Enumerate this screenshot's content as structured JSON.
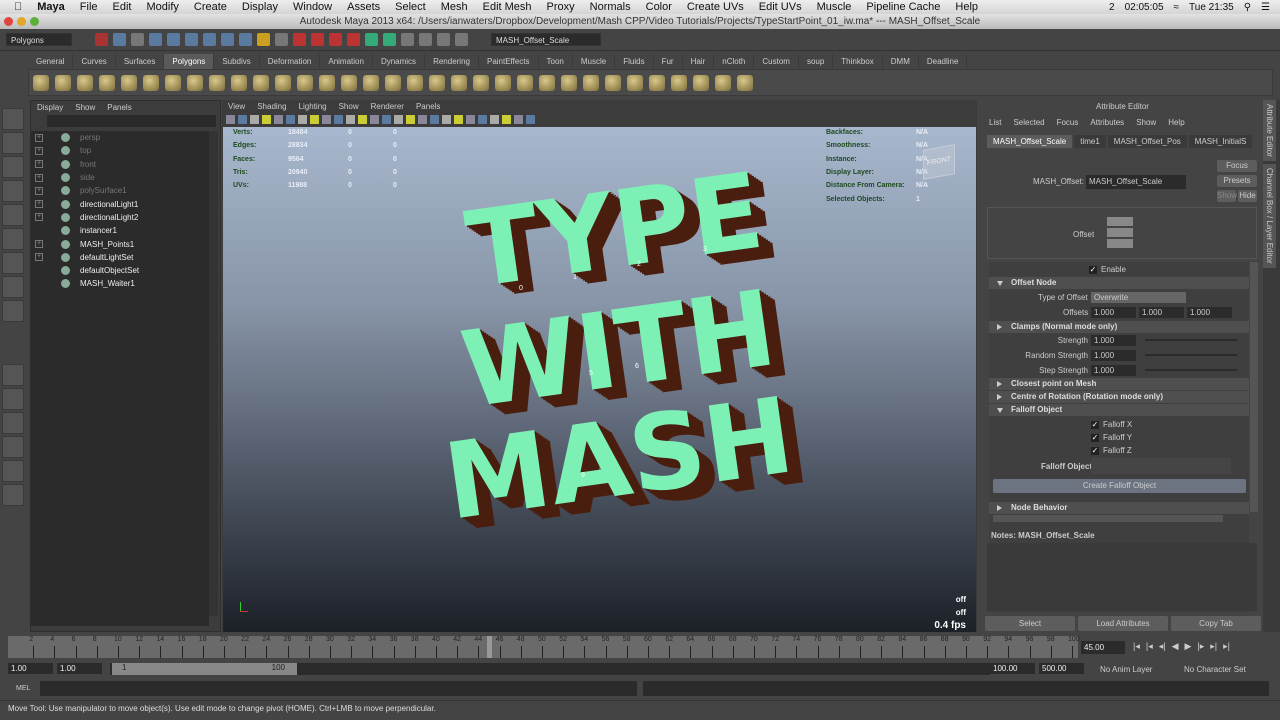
{
  "macmenu": {
    "app": "Maya",
    "items": [
      "File",
      "Edit",
      "Modify",
      "Create",
      "Display",
      "Window",
      "Assets",
      "Select",
      "Mesh",
      "Edit Mesh",
      "Proxy",
      "Normals",
      "Color",
      "Create UVs",
      "Edit UVs",
      "Muscle",
      "Pipeline Cache",
      "Help"
    ],
    "clock": "Tue 21:35",
    "timer": "02:05:05",
    "badge": "2"
  },
  "window_title": "Autodesk Maya 2013 x64: /Users/ianwaters/Dropbox/Development/Mash CPP/Video Tutorials/Projects/TypeStartPoint_01_iw.ma*  ---  MASH_Offset_Scale",
  "statusline": {
    "menuset": "Polygons",
    "name_field": "MASH_Offset_Scale"
  },
  "shelf_tabs": [
    "General",
    "Curves",
    "Surfaces",
    "Polygons",
    "Subdivs",
    "Deformation",
    "Animation",
    "Dynamics",
    "Rendering",
    "PaintEffects",
    "Toon",
    "Muscle",
    "Fluids",
    "Fur",
    "Hair",
    "nCloth",
    "Custom",
    "soup",
    "Thinkbox",
    "DMM",
    "Deadline"
  ],
  "shelf_active": "Polygons",
  "outliner": {
    "menu": [
      "Display",
      "Show",
      "Panels"
    ],
    "items": [
      {
        "label": "persp",
        "dim": true,
        "expand": true
      },
      {
        "label": "top",
        "dim": true,
        "expand": true
      },
      {
        "label": "front",
        "dim": true,
        "expand": true
      },
      {
        "label": "side",
        "dim": true,
        "expand": true
      },
      {
        "label": "polySurface1",
        "dim": true,
        "expand": true
      },
      {
        "label": "directionalLight1",
        "dim": false,
        "expand": true
      },
      {
        "label": "directionalLight2",
        "dim": false,
        "expand": true
      },
      {
        "label": "instancer1",
        "dim": false,
        "expand": false
      },
      {
        "label": "MASH_Points1",
        "dim": false,
        "expand": true
      },
      {
        "label": "defaultLightSet",
        "dim": false,
        "expand": true
      },
      {
        "label": "defaultObjectSet",
        "dim": false,
        "expand": false
      },
      {
        "label": "MASH_Waiter1",
        "dim": false,
        "expand": false
      }
    ]
  },
  "viewport": {
    "menu": [
      "View",
      "Shading",
      "Lighting",
      "Show",
      "Renderer",
      "Panels"
    ],
    "stats": [
      {
        "label": "Verts:",
        "v": [
          "18484",
          "0",
          "0"
        ]
      },
      {
        "label": "Edges:",
        "v": [
          "28834",
          "0",
          "0"
        ]
      },
      {
        "label": "Faces:",
        "v": [
          "9564",
          "0",
          "0"
        ]
      },
      {
        "label": "Tris:",
        "v": [
          "20940",
          "0",
          "0"
        ]
      },
      {
        "label": "UVs:",
        "v": [
          "11988",
          "0",
          "0"
        ]
      }
    ],
    "info": [
      {
        "label": "Backfaces:",
        "v": "N/A"
      },
      {
        "label": "Smoothness:",
        "v": "N/A"
      },
      {
        "label": "Instance:",
        "v": "N/A"
      },
      {
        "label": "Display Layer:",
        "v": "N/A"
      },
      {
        "label": "Distance From Camera:",
        "v": "N/A"
      },
      {
        "label": "Selected Objects:",
        "v": "1"
      }
    ],
    "text_lines": [
      "TYPE",
      "WITH",
      "MASH"
    ],
    "point_ids": [
      "0",
      "1",
      "2",
      "3",
      "5",
      "6",
      "9"
    ],
    "cube_label": "FRONT",
    "hud_off1": "off",
    "hud_off2": "off",
    "fps": "0.4 fps",
    "colors": {
      "letter_face": "#7df0b6",
      "letter_side": "#4a1e0e"
    }
  },
  "attr": {
    "title": "Attribute Editor",
    "menu": [
      "List",
      "Selected",
      "Focus",
      "Attributes",
      "Show",
      "Help"
    ],
    "tabs": [
      "MASH_Offset_Scale",
      "time1",
      "MASH_Offset_Pos",
      "MASH_InitialS"
    ],
    "node_label": "MASH_Offset:",
    "node_value": "MASH_Offset_Scale",
    "btn_focus": "Focus",
    "btn_presets": "Presets",
    "btn_show": "Show",
    "btn_hide": "Hide",
    "icon_label": "Offset",
    "enable": "Enable",
    "sec_offset": "Offset Node",
    "type_label": "Type of Offset",
    "type_value": "Overwrite",
    "offsets_label": "Offsets",
    "offsets": [
      "1.000",
      "1.000",
      "1.000"
    ],
    "sec_clamps": "Clamps (Normal mode only)",
    "sliders": [
      {
        "label": "Strength",
        "value": "1.000"
      },
      {
        "label": "Random Strength",
        "value": "1.000"
      },
      {
        "label": "Step Strength",
        "value": "1.000"
      }
    ],
    "sec_closest": "Closest point on Mesh",
    "sec_centre": "Centre of Rotation (Rotation mode only)",
    "sec_falloff": "Falloff Object",
    "falloff_checks": [
      "Falloff X",
      "Falloff Y",
      "Falloff Z"
    ],
    "falloff_obj_label": "Falloff Object",
    "create_falloff": "Create Falloff Object",
    "sec_node": "Node Behavior",
    "notes": "Notes:  MASH_Offset_Scale",
    "bottom_buttons": [
      "Select",
      "Load Attributes",
      "Copy Tab"
    ]
  },
  "side_tabs": [
    "Attribute Editor",
    "Channel Box / Layer Editor"
  ],
  "timeline": {
    "start": 2,
    "end": 100,
    "step": 2,
    "current": 45,
    "current_field": "45.00"
  },
  "range": {
    "start": "1.00",
    "inner_start": "1.00",
    "slider_start": "1",
    "slider_end": "100",
    "inner_end": "100.00",
    "end": "500.00",
    "anim_layer": "No Anim Layer",
    "char_set": "No Character Set"
  },
  "mel_label": "MEL",
  "help_line": "Move Tool: Use manipulator to move object(s). Use edit mode to change pivot (HOME).  Ctrl+LMB to move perpendicular."
}
